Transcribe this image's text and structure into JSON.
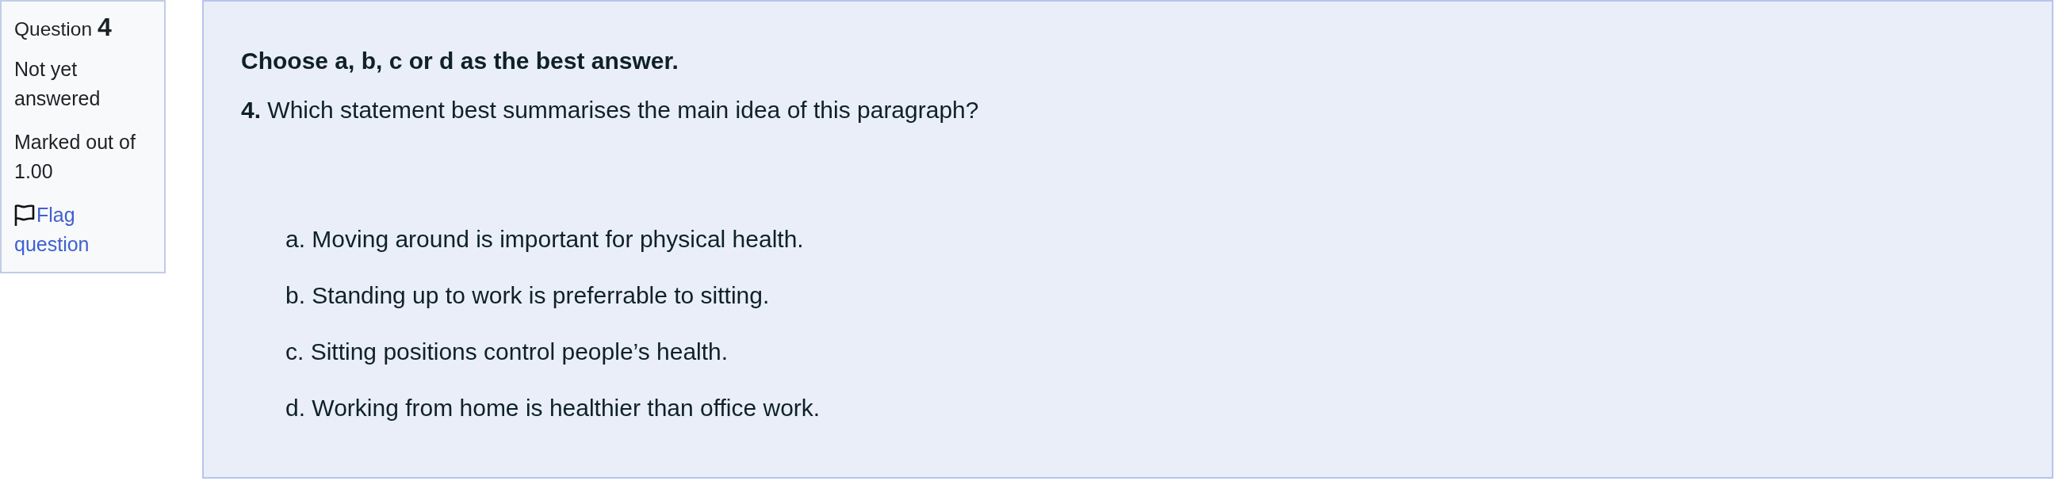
{
  "question_info": {
    "label": "Question",
    "number": "4",
    "state": "Not yet answered",
    "grade": "Marked out of 1.00",
    "flag": {
      "label": "Flag question",
      "flagged": false
    }
  },
  "question": {
    "instruction": "Choose a, b, c or d as the best answer.",
    "prompt": "**4.** Which statement best summarises the main idea of this paragraph?",
    "options": [
      {
        "text": "a. Moving around is important for physical health."
      },
      {
        "text": "b. Standing up to work is preferrable to sitting."
      },
      {
        "text": "c. Sitting positions control people’s health."
      },
      {
        "text": "d. Working from home is healthier than office work."
      }
    ]
  }
}
